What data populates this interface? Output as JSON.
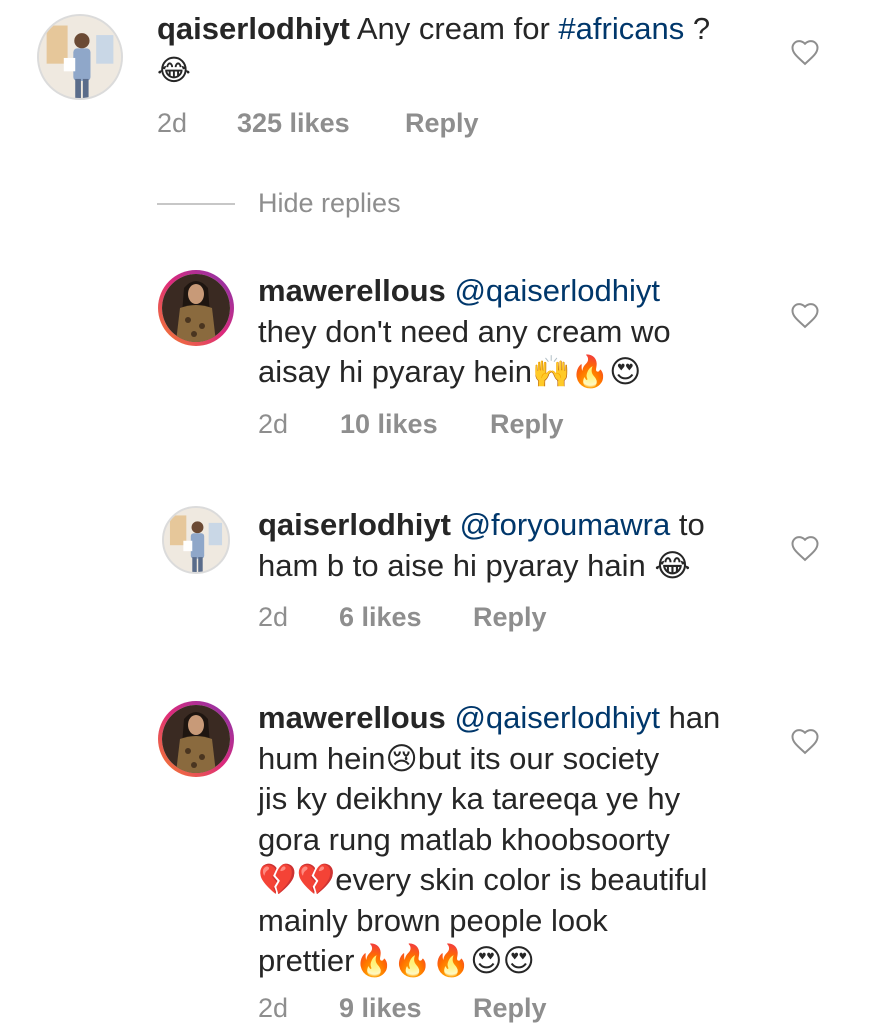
{
  "comments": [
    {
      "username": "qaiserlodhiyt",
      "text": "Any cream for",
      "hashtag": "#africans",
      "text_after": " ?",
      "line2": "😂",
      "time": "2d",
      "likes": "325 likes",
      "reply": "Reply"
    },
    {
      "username": "mawerellous",
      "mention": "@qaiserlodhiyt",
      "line1": "they don't need any cream wo",
      "line2": "aisay hi pyaray hein🙌🔥😍",
      "time": "2d",
      "likes": "10 likes",
      "reply": "Reply"
    },
    {
      "username": "qaiserlodhiyt",
      "mention": "@foryoumawra",
      "text_after": " to",
      "line1": "ham b to aise hi pyaray hain 😂",
      "time": "2d",
      "likes": "6 likes",
      "reply": "Reply"
    },
    {
      "username": "mawerellous",
      "mention": "@qaiserlodhiyt",
      "text_after": " han",
      "lines": [
        "hum hein😢but its our society",
        "jis ky deikhny ka tareeqa ye hy",
        "gora rung matlab khoobsoorty",
        "💔💔every skin color is beautiful",
        "mainly brown people look",
        "prettier🔥🔥🔥😍😍"
      ],
      "time": "2d",
      "likes": "9 likes",
      "reply": "Reply"
    }
  ],
  "hide_replies": "Hide replies",
  "colors": {
    "text": "#262626",
    "muted": "#8e8e8e",
    "link": "#00376b",
    "story_ring": [
      "#f58529",
      "#dd2a7b",
      "#8134af"
    ]
  },
  "icons": {
    "like": "heart-outline-icon"
  }
}
